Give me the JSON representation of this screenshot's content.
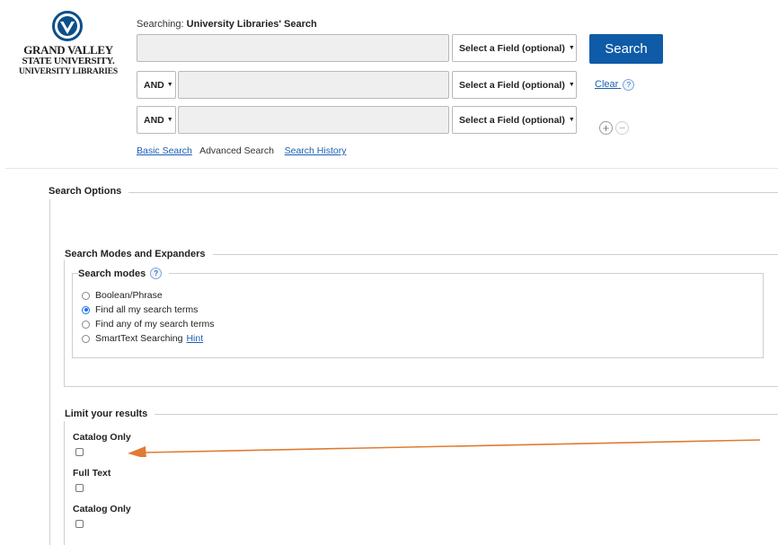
{
  "logo": {
    "icon": "gvsu-torch-logo-icon",
    "line1": "GRAND VALLEY",
    "line2": "STATE UNIVERSITY.",
    "line3": "UNIVERSITY LIBRARIES"
  },
  "search": {
    "searching_prefix": "Searching:",
    "searching_target": "University Libraries' Search",
    "rows": [
      {
        "term": "",
        "field_label": "Select a Field (optional)"
      },
      {
        "bool": "AND",
        "term": "",
        "field_label": "Select a Field (optional)"
      },
      {
        "bool": "AND",
        "term": "",
        "field_label": "Select a Field (optional)"
      }
    ],
    "search_button": "Search",
    "clear_link": "Clear",
    "help_glyph": "?",
    "add_row_glyph": "+",
    "remove_row_glyph": "−",
    "links": {
      "basic": "Basic Search",
      "advanced": "Advanced Search",
      "history": "Search History"
    }
  },
  "options": {
    "legend": "Search Options",
    "modes_section": {
      "legend": "Search Modes and Expanders",
      "modes_legend": "Search modes",
      "modes": [
        {
          "label": "Boolean/Phrase",
          "selected": false
        },
        {
          "label": "Find all my search terms",
          "selected": true
        },
        {
          "label": "Find any of my search terms",
          "selected": false
        },
        {
          "label": "SmartText Searching",
          "selected": false
        }
      ],
      "hint_link": "Hint"
    },
    "limits": {
      "legend": "Limit your results",
      "items": [
        {
          "label": "Catalog Only",
          "checked": false
        },
        {
          "label": "Full Text",
          "checked": false
        },
        {
          "label": "Catalog Only",
          "checked": false
        }
      ]
    }
  },
  "colors": {
    "search_button": "#0f5ba7",
    "link": "#1a5fb4",
    "annotation_arrow": "#e07b33",
    "radio_selected": "#1a73e8"
  }
}
